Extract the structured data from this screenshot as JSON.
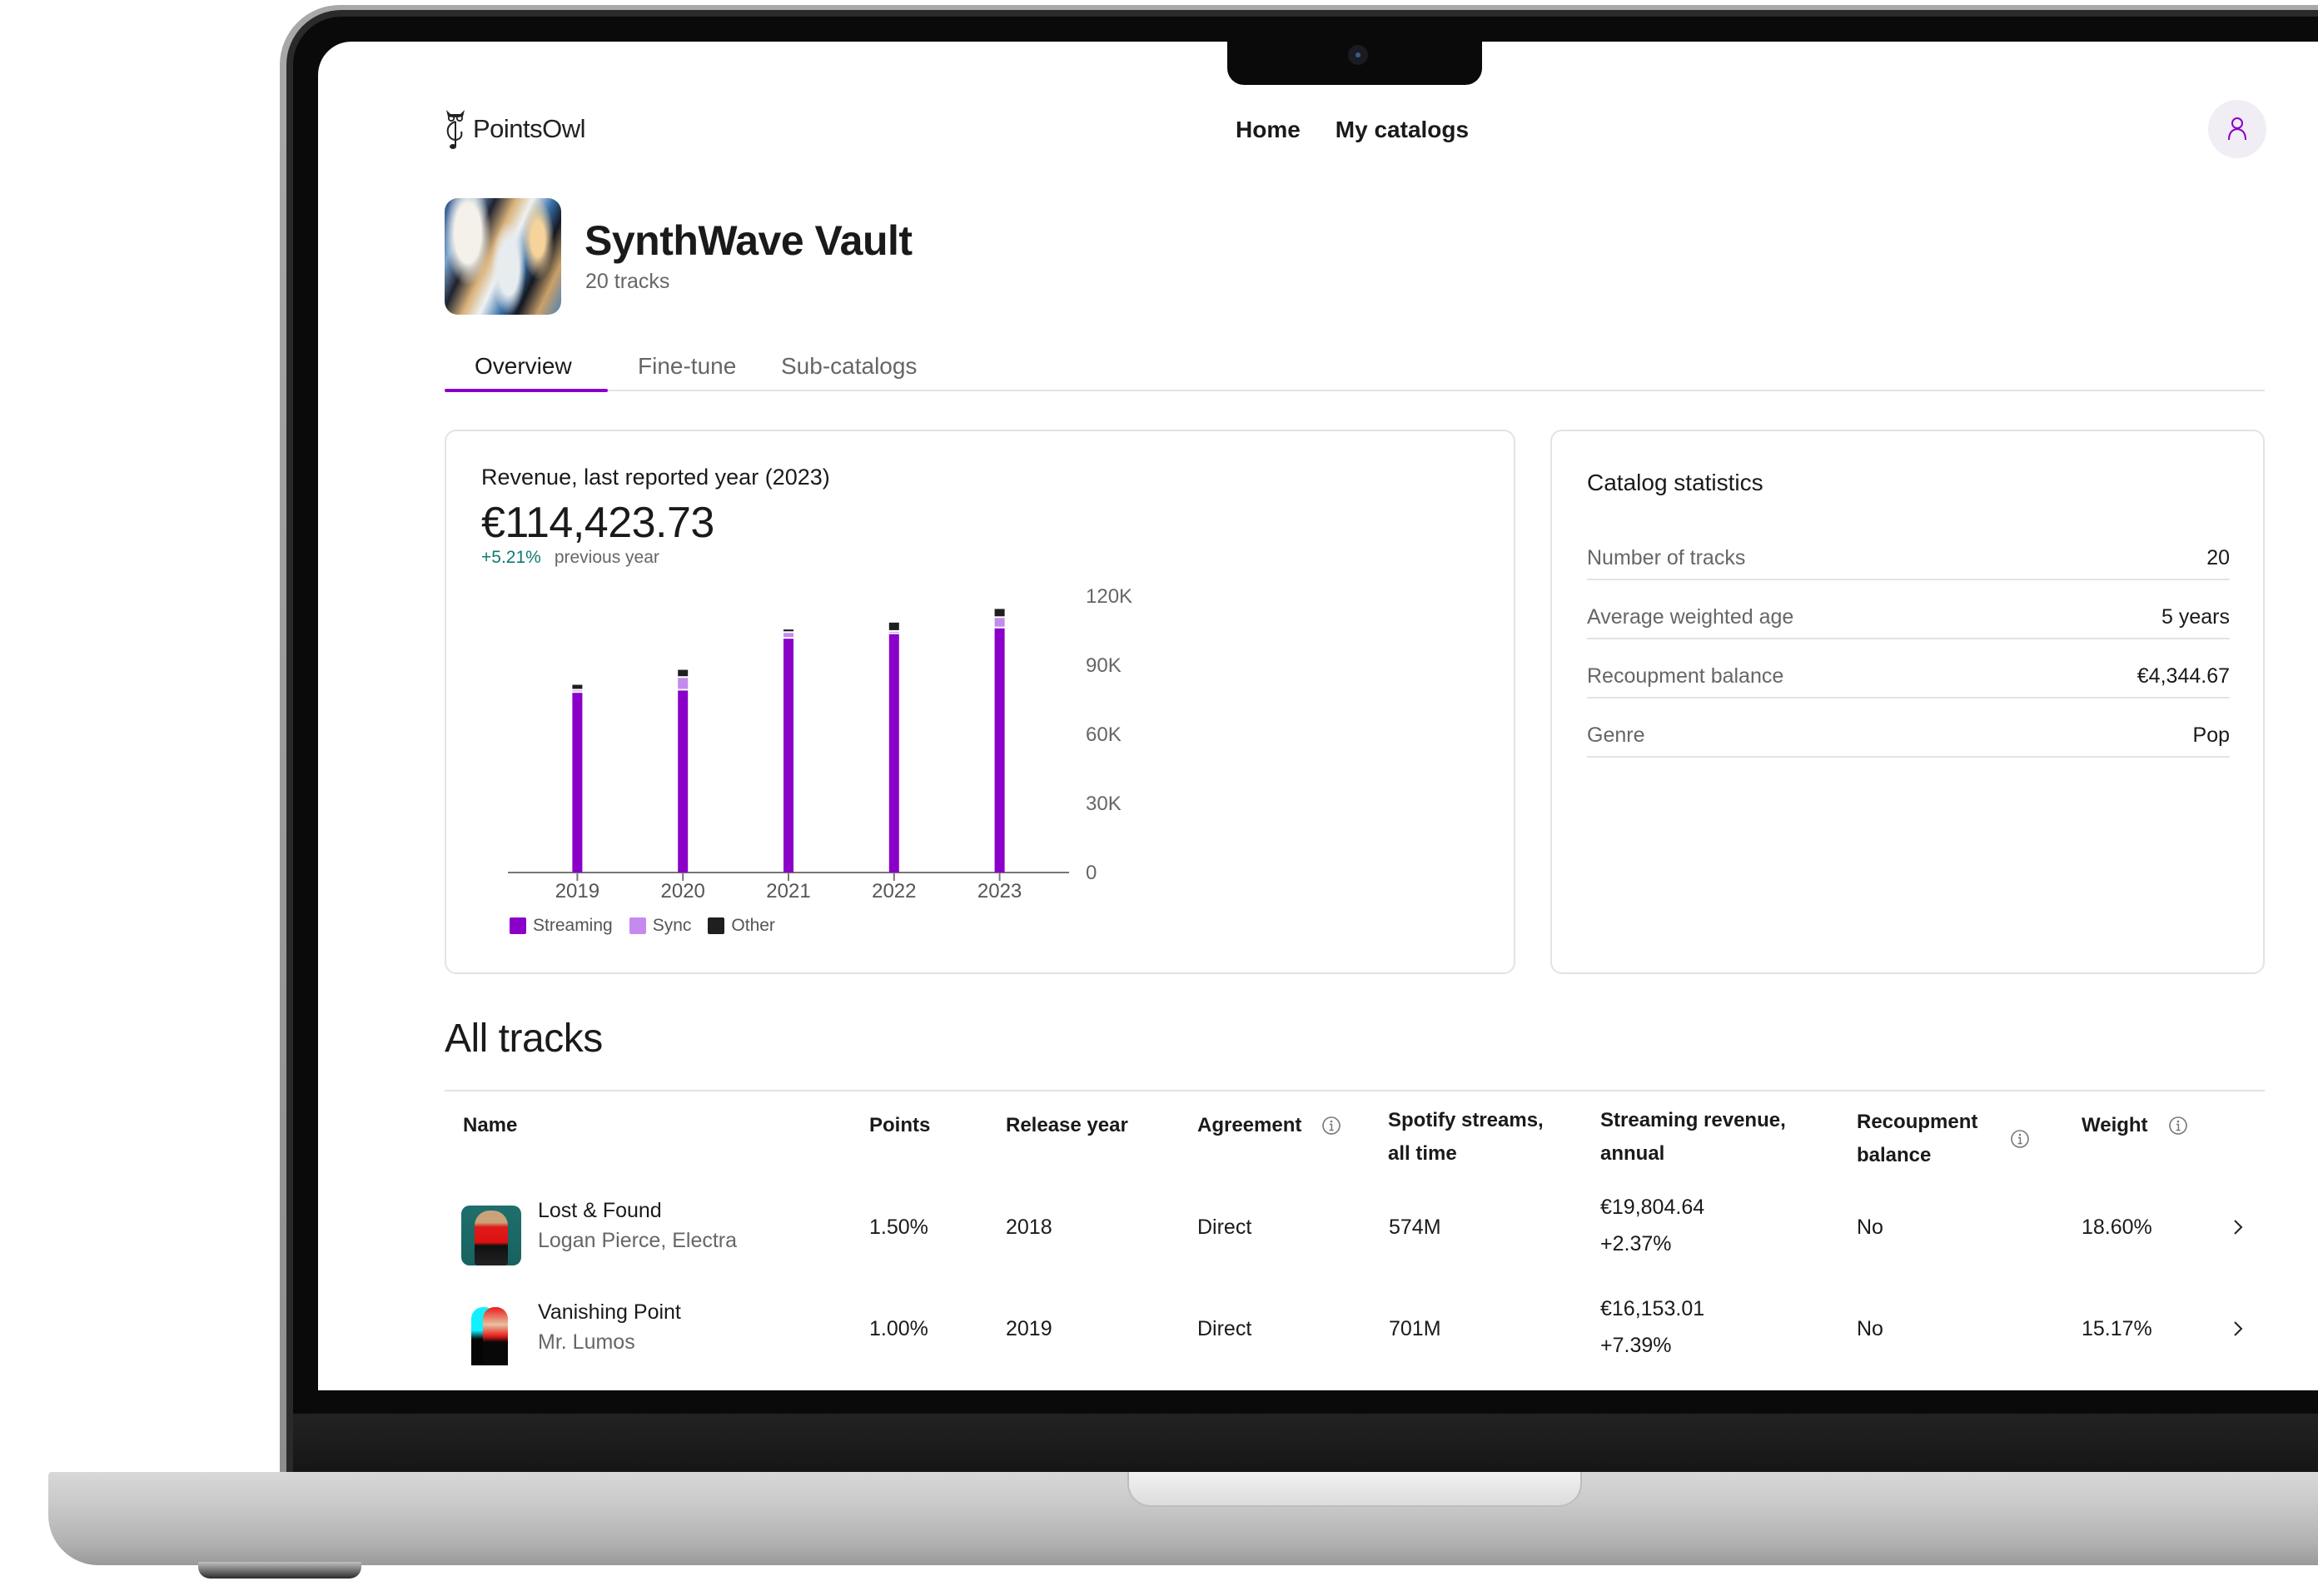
{
  "app": {
    "brand": "PointsOwl",
    "nav": [
      {
        "label": "Home"
      },
      {
        "label": "My catalogs"
      }
    ],
    "user_icon": "user-icon"
  },
  "catalog": {
    "title": "SynthWave Vault",
    "subtitle": "20 tracks",
    "cover_icon": "catalog-cover-image"
  },
  "tabs": [
    {
      "label": "Overview",
      "active": true
    },
    {
      "label": "Fine-tune",
      "active": false
    },
    {
      "label": "Sub-catalogs",
      "active": false
    }
  ],
  "revenue": {
    "label": "Revenue, last reported year (2023)",
    "value": "€114,423.73",
    "change": "+5.21%",
    "change_suffix": "previous year"
  },
  "colors": {
    "accent": "#8a00c8",
    "streaming": "#8a00c8",
    "sync": "#c58aee",
    "other": "#1f1f1f",
    "positive": "#0f7a73"
  },
  "chart_data": {
    "type": "bar",
    "stacked": true,
    "title": "Revenue, last reported year (2023)",
    "xlabel": "",
    "ylabel": "",
    "categories": [
      "2019",
      "2020",
      "2021",
      "2022",
      "2023"
    ],
    "series": [
      {
        "name": "Streaming",
        "values": [
          78000,
          79000,
          101500,
          103500,
          106000
        ]
      },
      {
        "name": "Sync",
        "values": [
          1000,
          5500,
          2500,
          1000,
          4500
        ]
      },
      {
        "name": "Other",
        "values": [
          2500,
          3500,
          1500,
          4000,
          3924
        ]
      }
    ],
    "ylim": [
      0,
      120000
    ],
    "yticks": [
      0,
      30000,
      60000,
      90000,
      120000
    ],
    "ytick_labels": [
      "0",
      "30K",
      "60K",
      "90K",
      "120K"
    ],
    "y_axis_side": "right",
    "grid": false,
    "legend": [
      "Streaming",
      "Sync",
      "Other"
    ],
    "legend_position": "bottom-left"
  },
  "stats": {
    "title": "Catalog statistics",
    "rows": [
      {
        "label": "Number of tracks",
        "value": "20"
      },
      {
        "label": "Average weighted age",
        "value": "5 years"
      },
      {
        "label": "Recoupment balance",
        "value": "€4,344.67"
      },
      {
        "label": "Genre",
        "value": "Pop"
      }
    ]
  },
  "tracks": {
    "title": "All tracks",
    "columns": [
      {
        "label": "Name",
        "info": false
      },
      {
        "label": "Points",
        "info": false
      },
      {
        "label": "Release year",
        "info": false
      },
      {
        "label": "Agreement",
        "info": true
      },
      {
        "label": "Spotify streams, all time",
        "info": false
      },
      {
        "label": "Streaming revenue, annual",
        "info": false
      },
      {
        "label": "Recoupment balance",
        "info": true
      },
      {
        "label": "Weight",
        "info": true
      }
    ],
    "rows": [
      {
        "name": "Lost & Found",
        "artist": "Logan Pierce, Electra",
        "points": "1.50%",
        "release_year": "2018",
        "agreement": "Direct",
        "streams": "574M",
        "revenue": "€19,804.64",
        "revenue_change": "+2.37%",
        "recoupment": "No",
        "weight": "18.60%"
      },
      {
        "name": "Vanishing Point",
        "artist": "Mr. Lumos",
        "points": "1.00%",
        "release_year": "2019",
        "agreement": "Direct",
        "streams": "701M",
        "revenue": "€16,153.01",
        "revenue_change": "+7.39%",
        "recoupment": "No",
        "weight": "15.17%"
      }
    ]
  }
}
